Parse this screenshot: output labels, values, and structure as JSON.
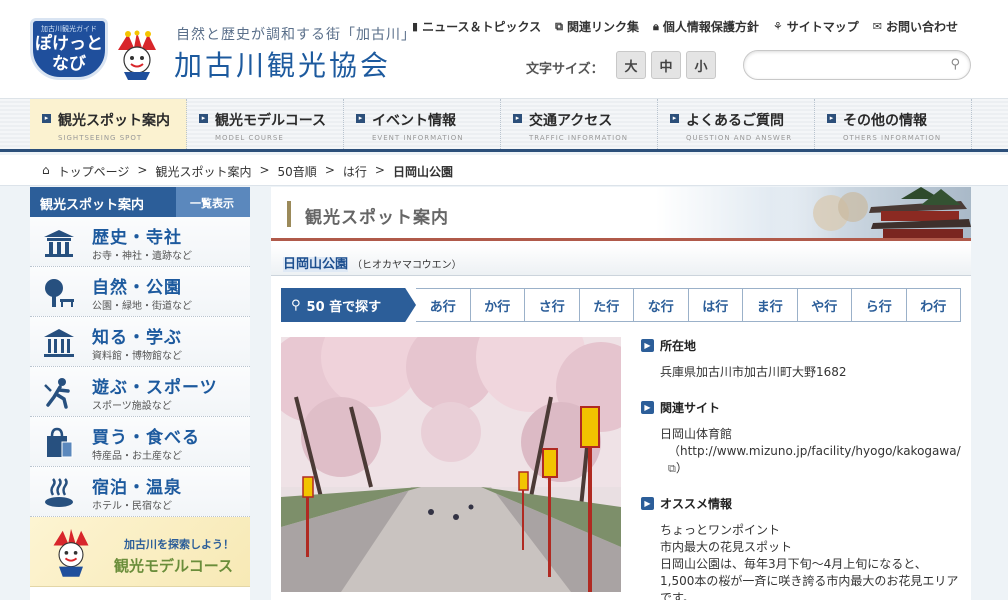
{
  "header": {
    "logo_small": "加古川観光ガイド",
    "logo_main_1": "ぽけっと",
    "logo_main_2": "なび",
    "tagline": "自然と歴史が調和する街「加古川」",
    "site_title": "加古川観光協会",
    "util_links": [
      {
        "label": "ニュース＆トピックス",
        "icon": "document-icon"
      },
      {
        "label": "関連リンク集",
        "icon": "link-icon"
      },
      {
        "label": "個人情報保護方針",
        "icon": "lock-icon"
      },
      {
        "label": "サイトマップ",
        "icon": "sitemap-icon"
      },
      {
        "label": "お問い合わせ",
        "icon": "mail-icon"
      }
    ],
    "font_size_label": "文字サイズ：",
    "font_sizes": [
      "大",
      "中",
      "小"
    ],
    "search_placeholder": ""
  },
  "nav": [
    {
      "label": "観光スポット案内",
      "sub": "SIGHTSEEING SPOT",
      "active": true
    },
    {
      "label": "観光モデルコース",
      "sub": "MODEL COURSE"
    },
    {
      "label": "イベント情報",
      "sub": "EVENT INFORMATION"
    },
    {
      "label": "交通アクセス",
      "sub": "TRAFFIC INFORMATION"
    },
    {
      "label": "よくあるご質問",
      "sub": "QUESTION AND ANSWER"
    },
    {
      "label": "その他の情報",
      "sub": "OTHERS INFORMATION"
    }
  ],
  "breadcrumb": [
    "トップページ",
    "観光スポット案内",
    "50音順",
    "は行",
    "日岡山公園"
  ],
  "breadcrumb_sep": ">",
  "sidebar": {
    "title": "観光スポット案内",
    "all_label": "一覧表示",
    "items": [
      {
        "label": "歴史・寺社",
        "sub": "お寺・神社・遺跡など",
        "icon": "shrine-icon"
      },
      {
        "label": "自然・公園",
        "sub": "公園・緑地・街道など",
        "icon": "tree-icon"
      },
      {
        "label": "知る・学ぶ",
        "sub": "資料館・博物館など",
        "icon": "museum-icon"
      },
      {
        "label": "遊ぶ・スポーツ",
        "sub": "スポーツ施設など",
        "icon": "sports-icon"
      },
      {
        "label": "買う・食べる",
        "sub": "特産品・お土産など",
        "icon": "shopping-bag-icon"
      },
      {
        "label": "宿泊・温泉",
        "sub": "ホテル・民宿など",
        "icon": "hot-spring-icon"
      }
    ],
    "banner_line1": "加古川を探索しよう！",
    "banner_line2": "観光モデルコース"
  },
  "main": {
    "title": "観光スポット案内",
    "spot_name": "日岡山公園",
    "spot_kana": "（ヒオカヤマコウエン）",
    "kana_search_label": "50 音で探す",
    "kana_rows": [
      "あ行",
      "か行",
      "さ行",
      "た行",
      "な行",
      "は行",
      "ま行",
      "や行",
      "ら行",
      "わ行"
    ],
    "info": {
      "address_head": "所在地",
      "address": "兵庫県加古川市加古川町大野1682",
      "site_head": "関連サイト",
      "site_name": "日岡山体育館",
      "site_url": "（http://www.mizuno.jp/facility/hyogo/kakogawa/",
      "site_url_close": "）",
      "reco_head": "オススメ情報",
      "reco_lines": [
        "ちょっとワンポイント",
        "市内最大の花見スポット",
        "日岡山公園は、毎年3月下旬～4月上旬になると、",
        "1,500本の桜が一斉に咲き誇る市内最大のお花見エリア",
        "です。"
      ]
    }
  },
  "colors": {
    "brand_blue": "#2c5e99",
    "title_blue": "#1d5a9e",
    "nav_active": "#fbf2d0",
    "banner_red": "#b05a4a"
  }
}
